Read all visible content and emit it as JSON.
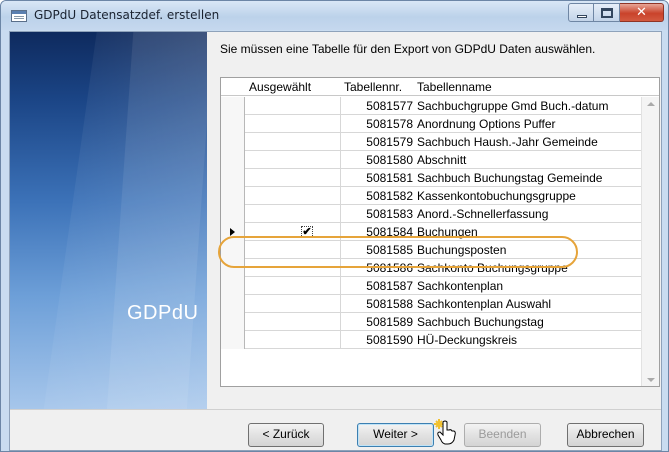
{
  "window": {
    "title": "GDPdU Datensatzdef. erstellen"
  },
  "side_panel": {
    "brand": "GDPdU"
  },
  "instruction": "Sie müssen eine Tabelle für den Export von GDPdU Daten auswählen.",
  "table": {
    "columns": [
      "Ausgewählt",
      "Tabellennr.",
      "Tabellenname"
    ],
    "rows": [
      {
        "nr": "5081577",
        "name": "Sachbuchgruppe Gmd Buch.-datum",
        "checked": false,
        "current": false
      },
      {
        "nr": "5081578",
        "name": "Anordnung Options Puffer",
        "checked": false,
        "current": false
      },
      {
        "nr": "5081579",
        "name": "Sachbuch Haush.-Jahr Gemeinde",
        "checked": false,
        "current": false
      },
      {
        "nr": "5081580",
        "name": "Abschnitt",
        "checked": false,
        "current": false
      },
      {
        "nr": "5081581",
        "name": "Sachbuch Buchungstag Gemeinde",
        "checked": false,
        "current": false
      },
      {
        "nr": "5081582",
        "name": "Kassenkontobuchungsgruppe",
        "checked": false,
        "current": false
      },
      {
        "nr": "5081583",
        "name": "Anord.-Schnellerfassung",
        "checked": false,
        "current": false
      },
      {
        "nr": "5081584",
        "name": "Buchungen",
        "checked": true,
        "current": true
      },
      {
        "nr": "5081585",
        "name": "Buchungsposten",
        "checked": false,
        "current": false
      },
      {
        "nr": "5081586",
        "name": "Sachkonto Buchungsgruppe",
        "checked": false,
        "current": false
      },
      {
        "nr": "5081587",
        "name": "Sachkontenplan",
        "checked": false,
        "current": false
      },
      {
        "nr": "5081588",
        "name": "Sachkontenplan Auswahl",
        "checked": false,
        "current": false
      },
      {
        "nr": "5081589",
        "name": "Sachbuch Buchungstag",
        "checked": false,
        "current": false
      },
      {
        "nr": "5081590",
        "name": "HÜ-Deckungskreis",
        "checked": false,
        "current": false
      }
    ]
  },
  "buttons": {
    "back": "< Zurück",
    "next": "Weiter >",
    "finish": "Beenden",
    "cancel": "Abbrechen"
  },
  "colors": {
    "highlight": "#e6a43a",
    "close_button": "#c9432b"
  },
  "icons": {
    "app": "table-icon",
    "cursor": "hand-pointer-icon"
  }
}
